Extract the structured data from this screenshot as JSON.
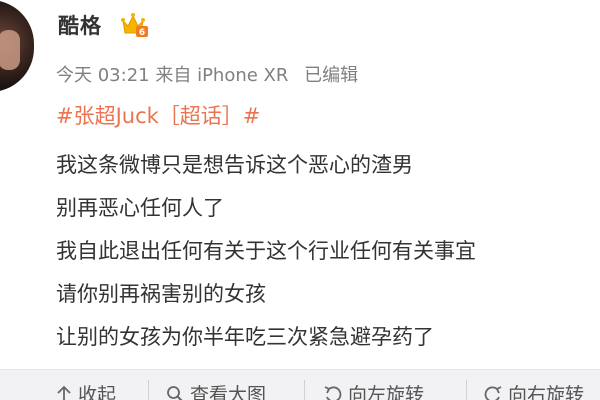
{
  "user": {
    "name": "酷格",
    "badge_icon": "vip-crown-icon",
    "badge_level": "6"
  },
  "meta": {
    "time": "今天 03:21",
    "source": "来自 iPhone XR",
    "edited": "已编辑"
  },
  "topic": {
    "text": "#张超Juck［超话］#",
    "color": "#eb7350"
  },
  "content": {
    "lines": [
      "我这条微博只是想告诉这个恶心的渣男",
      "别再恶心任何人了",
      "我自此退出任何有关于这个行业任何有关事宜",
      "请你别再祸害别的女孩",
      "让别的女孩为你半年吃三次紧急避孕药了"
    ]
  },
  "footer": {
    "collapse_label": "收起",
    "view_large_label": "查看大图",
    "rotate_left_label": "向左旋转",
    "rotate_right_label": "向右旋转",
    "collapse_icon": "arrow-up-icon",
    "view_large_icon": "magnifier-icon",
    "rotate_left_icon": "rotate-left-icon",
    "rotate_right_icon": "rotate-right-icon"
  }
}
